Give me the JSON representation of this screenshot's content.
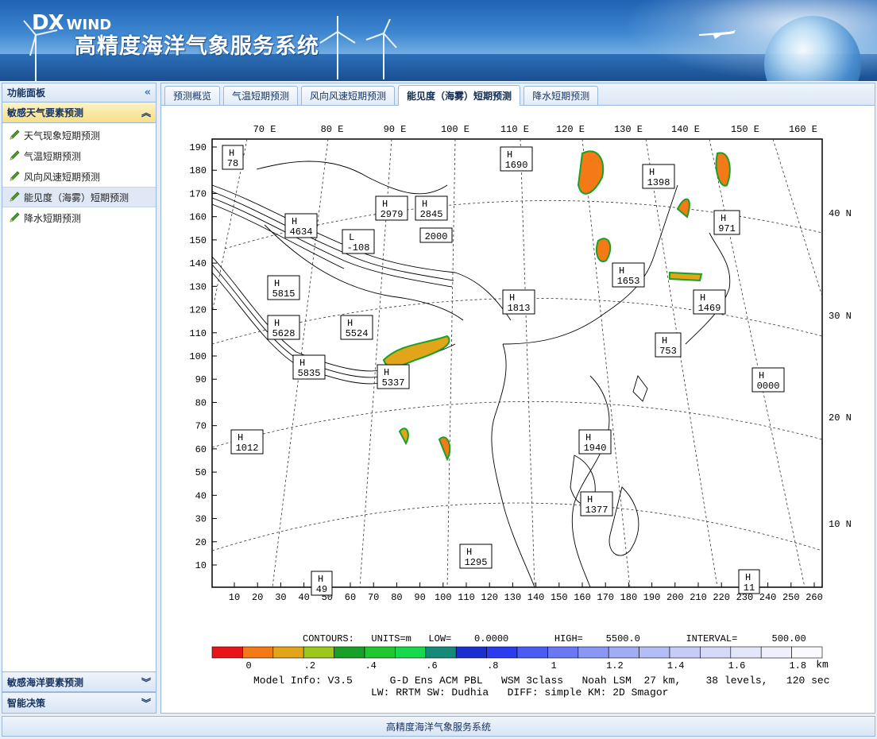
{
  "header": {
    "logo_dx": "DX",
    "logo_wind": "WIND",
    "title": "高精度海洋气象服务系统"
  },
  "sidebar": {
    "panel_title": "功能面板",
    "active_section": "敏感天气要素预测",
    "items": [
      {
        "label": "天气现象短期预测"
      },
      {
        "label": "气温短期预测"
      },
      {
        "label": "风向风速短期预测"
      },
      {
        "label": "能见度（海雾）短期预测"
      },
      {
        "label": "降水短期预测"
      }
    ],
    "selected_index": 3,
    "bottom_sections": [
      {
        "label": "敏感海洋要素预测"
      },
      {
        "label": "智能决策"
      }
    ]
  },
  "tabs": [
    {
      "label": "预测概览"
    },
    {
      "label": "气温短期预测"
    },
    {
      "label": "风向风速短期预测"
    },
    {
      "label": "能见度（海雾）短期预测"
    },
    {
      "label": "降水短期预测"
    }
  ],
  "active_tab": 3,
  "map": {
    "top_lon_labels": [
      "70 E",
      "80 E",
      "90 E",
      "100 E",
      "110 E",
      "120 E",
      "130 E",
      "140 E",
      "150 E",
      "160 E"
    ],
    "right_lat_labels": [
      "40 N",
      "30 N",
      "20 N",
      "10 N"
    ],
    "left_ticks": [
      "190",
      "180",
      "170",
      "160",
      "150",
      "140",
      "130",
      "120",
      "110",
      "100",
      "90",
      "80",
      "70",
      "60",
      "50",
      "40",
      "30",
      "20",
      "10"
    ],
    "bottom_ticks": [
      "10",
      "20",
      "30",
      "40",
      "50",
      "60",
      "70",
      "80",
      "90",
      "100",
      "110",
      "120",
      "130",
      "140",
      "150",
      "160",
      "170",
      "180",
      "190",
      "200",
      "210",
      "220",
      "230",
      "240",
      "250",
      "260"
    ],
    "hl_labels": [
      {
        "type": "H",
        "value": "78"
      },
      {
        "type": "H",
        "value": "1690"
      },
      {
        "type": "H",
        "value": "1398"
      },
      {
        "type": "H",
        "value": "2979"
      },
      {
        "type": "H",
        "value": "2845"
      },
      {
        "type": "H",
        "value": "4634"
      },
      {
        "type": "L",
        "value": "-108"
      },
      {
        "type": "",
        "value": "2000"
      },
      {
        "type": "H",
        "value": "971"
      },
      {
        "type": "H",
        "value": "5815"
      },
      {
        "type": "H",
        "value": "1653"
      },
      {
        "type": "H",
        "value": "1813"
      },
      {
        "type": "H",
        "value": "1469"
      },
      {
        "type": "H",
        "value": "5628"
      },
      {
        "type": "H",
        "value": "5524"
      },
      {
        "type": "H",
        "value": "753"
      },
      {
        "type": "H",
        "value": "5835"
      },
      {
        "type": "H",
        "value": "5337"
      },
      {
        "type": "H",
        "value": "0000"
      },
      {
        "type": "H",
        "value": "1012"
      },
      {
        "type": "H",
        "value": "1940"
      },
      {
        "type": "H",
        "value": "1377"
      },
      {
        "type": "H",
        "value": "1295"
      },
      {
        "type": "H",
        "value": "49"
      },
      {
        "type": "H",
        "value": "11"
      }
    ]
  },
  "legend": {
    "contours_line": "CONTOURS:   UNITS=m   LOW=    0.0000        HIGH=    5500.0        INTERVAL=      500.00",
    "scale_labels": [
      "0",
      ".2",
      ".4",
      ".6",
      ".8",
      "1",
      "1.2",
      "1.4",
      "1.6",
      "1.8"
    ],
    "unit": "km",
    "colors": [
      "#e8141a",
      "#f47a18",
      "#e2a418",
      "#9cc81c",
      "#18a028",
      "#20c830",
      "#18d84c",
      "#168a78",
      "#1a2fd0",
      "#2a3cf0",
      "#4a5cf4",
      "#6a78f4",
      "#8898f4",
      "#a0acf4",
      "#b4bef6",
      "#c6ccf8",
      "#d6daf8",
      "#e4e6fa",
      "#f0f0fc",
      "#fafafe"
    ],
    "model_info_1": "Model Info: V3.5      G-D Ens ACM PBL   WSM 3class   Noah LSM  27 km,    38 levels,   120 sec",
    "model_info_2": "LW: RRTM SW: Dudhia   DIFF: simple KM: 2D Smagor"
  },
  "footer": {
    "text": "高精度海洋气象服务系统"
  }
}
